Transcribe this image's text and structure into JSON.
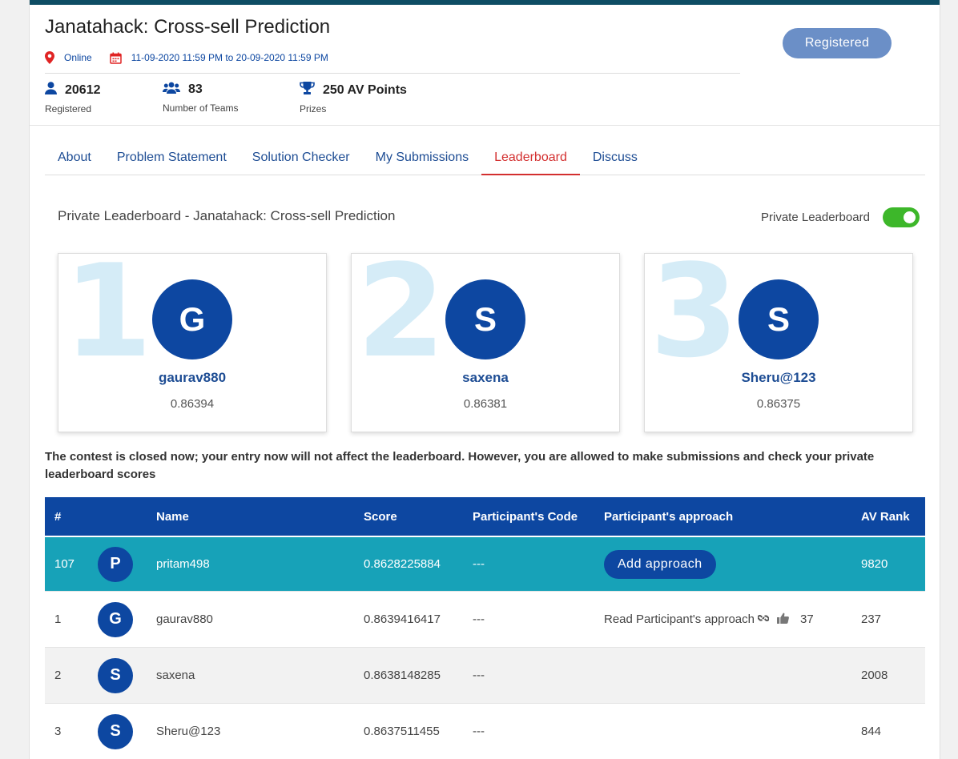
{
  "contest": {
    "title": "Janatahack: Cross-sell Prediction",
    "location": "Online",
    "dates": "11-09-2020 11:59 PM to 20-09-2020 11:59 PM",
    "registered_button": "Registered"
  },
  "stats": [
    {
      "icon": "user-icon",
      "value": "20612",
      "label": "Registered"
    },
    {
      "icon": "users-icon",
      "value": "83",
      "label": "Number of Teams"
    },
    {
      "icon": "trophy-icon",
      "value": "250 AV Points",
      "label": "Prizes"
    }
  ],
  "tabs": [
    "About",
    "Problem Statement",
    "Solution Checker",
    "My Submissions",
    "Leaderboard",
    "Discuss"
  ],
  "active_tab": "Leaderboard",
  "leaderboard": {
    "title": "Private Leaderboard - Janatahack: Cross-sell Prediction",
    "toggle_label": "Private Leaderboard",
    "toggle_on": true
  },
  "podium": [
    {
      "rank": "1",
      "initial": "G",
      "name": "gaurav880",
      "score": "0.86394"
    },
    {
      "rank": "2",
      "initial": "S",
      "name": "saxena",
      "score": "0.86381"
    },
    {
      "rank": "3",
      "initial": "S",
      "name": "Sheru@123",
      "score": "0.86375"
    }
  ],
  "notice": "The contest is closed now; your entry now will not affect the leaderboard. However, you are allowed to make submissions and check your private leaderboard scores",
  "table": {
    "headers": {
      "rank": "#",
      "name": "Name",
      "score": "Score",
      "code": "Participant's Code",
      "approach": "Participant's approach",
      "av_rank": "AV Rank"
    },
    "rows": [
      {
        "rank": "107",
        "initial": "P",
        "name": "pritam498",
        "score": "0.8628225884",
        "code": "---",
        "approach_button": "Add approach",
        "av_rank": "9820"
      },
      {
        "rank": "1",
        "initial": "G",
        "name": "gaurav880",
        "score": "0.8639416417",
        "code": "---",
        "approach_text": "Read Participant's approach",
        "likes": "37",
        "av_rank": "237"
      },
      {
        "rank": "2",
        "initial": "S",
        "name": "saxena",
        "score": "0.8638148285",
        "code": "---",
        "av_rank": "2008"
      },
      {
        "rank": "3",
        "initial": "S",
        "name": "Sheru@123",
        "score": "0.8637511455",
        "code": "---",
        "av_rank": "844"
      }
    ]
  },
  "colors": {
    "brand_blue": "#0d47a1",
    "highlight_row": "#17a2b8",
    "active_tab": "#d32f2f",
    "toggle_on": "#3db72a",
    "registered_button": "#6b8fc7"
  }
}
